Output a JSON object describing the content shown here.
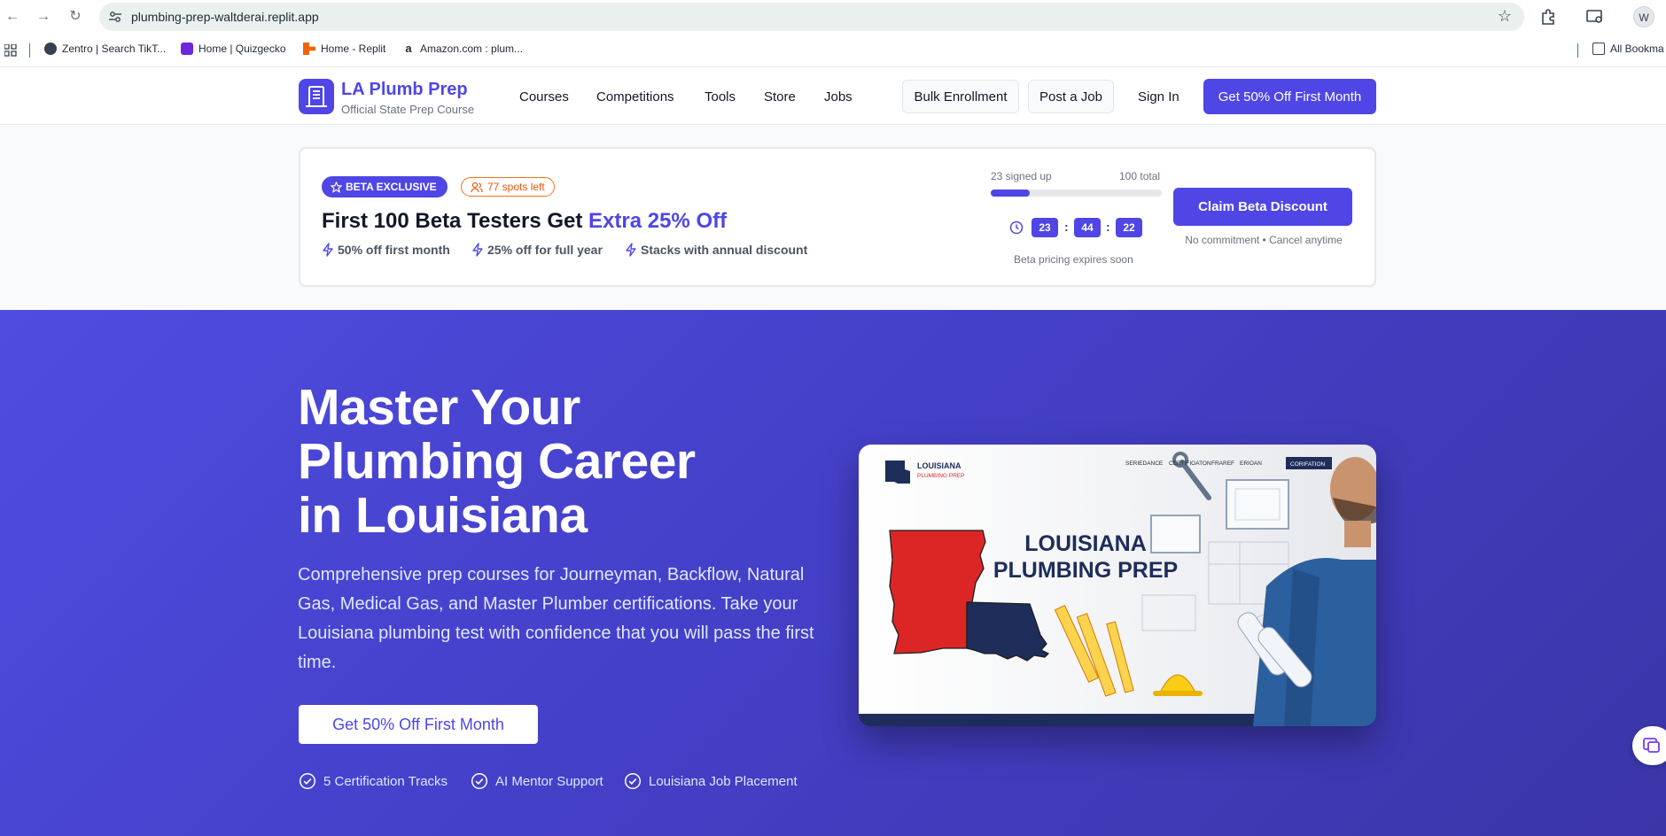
{
  "browser": {
    "url": "plumbing-prep-waltderai.replit.app",
    "profile_initial": "W",
    "bookmarks": [
      {
        "label": "Zentro | Search TikT..."
      },
      {
        "label": "Home | Quizgecko"
      },
      {
        "label": "Home - Replit"
      },
      {
        "label": "Amazon.com : plum..."
      }
    ],
    "all_bookmarks_label": "All Bookma"
  },
  "header": {
    "logo_title": "LA Plumb Prep",
    "logo_subtitle": "Official State Prep Course",
    "nav": [
      "Courses",
      "Competitions",
      "Tools",
      "Store",
      "Jobs"
    ],
    "bulk_enrollment": "Bulk Enrollment",
    "post_job": "Post a Job",
    "sign_in": "Sign In",
    "cta": "Get 50% Off First Month",
    "brand_color": "#4f46e5"
  },
  "beta": {
    "badge": "BETA EXCLUSIVE",
    "spots_left": "77 spots left",
    "title_main": "First 100 Beta Testers Get ",
    "title_accent": "Extra 25% Off",
    "perks": [
      "50% off first month",
      "25% off for full year",
      "Stacks with annual discount"
    ],
    "signed_up": "23 signed up",
    "total": "100 total",
    "progress_fraction": 0.23,
    "timer": {
      "hours": "23",
      "minutes": "44",
      "seconds": "22",
      "sep": ":"
    },
    "expires": "Beta pricing expires soon",
    "claim_button": "Claim Beta Discount",
    "no_commitment": "No commitment • Cancel anytime"
  },
  "hero": {
    "title_line1": "Master Your",
    "title_line2": "Plumbing Career",
    "title_line3": "in Louisiana",
    "description": "Comprehensive prep courses for Journeyman, Backflow, Natural Gas, Medical Gas, and Master Plumber certifications. Take your Louisiana plumbing test with confidence that you will pass the first time.",
    "cta": "Get 50% Off First Month",
    "features": [
      "5 Certification Tracks",
      "AI Mentor Support",
      "Louisiana Job Placement"
    ],
    "image": {
      "brand_top": "LOUISIANA",
      "brand_bottom": "PLUMBING PREP",
      "headline_line1": "LOUISIANA",
      "headline_line2": "PLUMBING PREP",
      "menu": [
        "SERIEDANCE",
        "CERTIFIOATON",
        "FRAREF",
        "ERIOAN",
        "CORIFATION"
      ]
    }
  }
}
